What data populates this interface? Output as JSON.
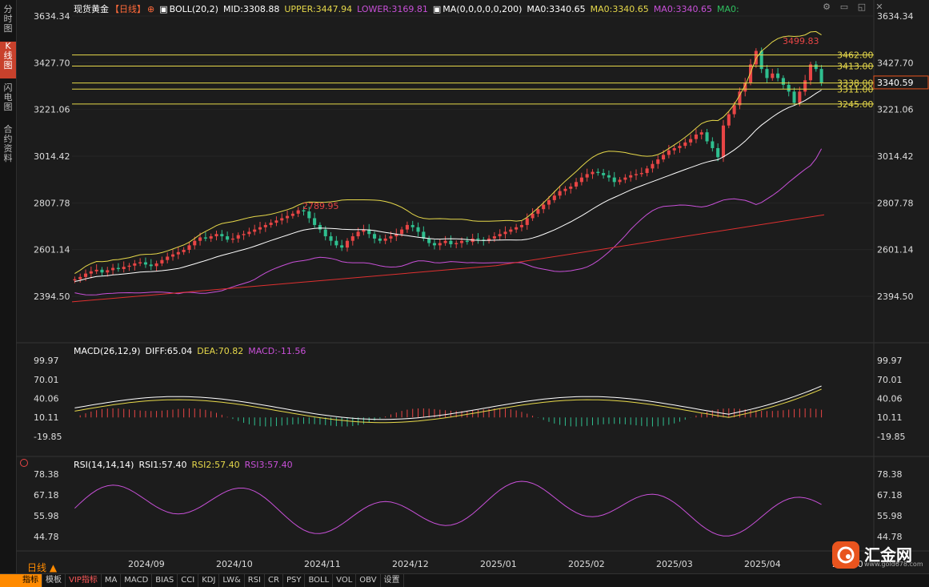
{
  "sidebar": {
    "tabs": [
      {
        "label": "分时图"
      },
      {
        "label": "K线图"
      },
      {
        "label": "闪电图"
      },
      {
        "label": "合约资料"
      }
    ]
  },
  "header": {
    "symbol": "现货黄金",
    "period": "【日线】",
    "boll": "BOLL(20,2)",
    "mid": "MID:3308.88",
    "upper": "UPPER:3447.94",
    "lower": "LOWER:3169.81",
    "ma": "MA(0,0,0,0,0,200)",
    "ma0a": "MA0:3340.65",
    "ma0b": "MA0:3340.65",
    "ma0c": "MA0:3340.65",
    "ma0d": "MA0:"
  },
  "macd_legend": {
    "title": "MACD(26,12,9)",
    "diff": "DIFF:65.04",
    "dea": "DEA:70.82",
    "macd": "MACD:-11.56"
  },
  "rsi_legend": {
    "title": "RSI(14,14,14)",
    "rsi1": "RSI1:57.40",
    "rsi2": "RSI2:57.40",
    "rsi3": "RSI3:57.40"
  },
  "price_axis": [
    "3634.34",
    "3427.70",
    "3221.06",
    "3014.42",
    "2807.78",
    "2601.14",
    "2394.50"
  ],
  "macd_axis": [
    "99.97",
    "70.01",
    "40.06",
    "10.11",
    "-19.85"
  ],
  "rsi_axis": [
    "78.38",
    "67.18",
    "55.98",
    "44.78"
  ],
  "date_axis": [
    "2024/09",
    "2024/10",
    "2024/11",
    "2024/12",
    "2025/01",
    "2025/02",
    "2025/03",
    "2025/04",
    "2025/0"
  ],
  "hlines": [
    {
      "label": "3462.00",
      "value": 3462
    },
    {
      "label": "3413.00",
      "value": 3413
    },
    {
      "label": "3338.00",
      "value": 3338
    },
    {
      "label": "3311.00",
      "value": 3311
    },
    {
      "label": "3245.00",
      "value": 3245
    }
  ],
  "annotations": {
    "high": "3499.83",
    "peak": "2789.95"
  },
  "current_price": "3340.59",
  "period_label": "日线 ▲",
  "bottom_tabs": [
    "指标",
    "模板",
    "VIP指标",
    "MA",
    "MACD",
    "BIAS",
    "CCI",
    "KDJ",
    "LW&",
    "RSI",
    "CR",
    "PSY",
    "BOLL",
    "VOL",
    "OBV",
    "设置"
  ],
  "logo": {
    "text": "汇金网",
    "url": "www.gold678.com"
  },
  "colors": {
    "up": "#e84545",
    "down": "#2fbf8f",
    "boll_upper": "#e6d84a",
    "boll_mid": "#ffffff",
    "boll_lower": "#c850d8",
    "ma200": "#e03030"
  },
  "chart_data": {
    "type": "candlestick",
    "ylim": [
      2394.5,
      3634.34
    ],
    "closes": [
      2470,
      2480,
      2495,
      2505,
      2512,
      2500,
      2510,
      2520,
      2515,
      2525,
      2530,
      2540,
      2545,
      2535,
      2528,
      2540,
      2555,
      2570,
      2580,
      2590,
      2600,
      2620,
      2640,
      2655,
      2650,
      2660,
      2670,
      2660,
      2645,
      2650,
      2665,
      2670,
      2680,
      2690,
      2700,
      2710,
      2720,
      2730,
      2740,
      2750,
      2760,
      2775,
      2770,
      2740,
      2710,
      2690,
      2660,
      2640,
      2620,
      2610,
      2640,
      2660,
      2680,
      2690,
      2670,
      2650,
      2640,
      2650,
      2660,
      2670,
      2690,
      2710,
      2700,
      2680,
      2650,
      2630,
      2620,
      2630,
      2640,
      2625,
      2630,
      2640,
      2635,
      2650,
      2645,
      2640,
      2650,
      2660,
      2670,
      2680,
      2690,
      2700,
      2710,
      2740,
      2760,
      2780,
      2800,
      2820,
      2840,
      2860,
      2870,
      2880,
      2900,
      2920,
      2935,
      2945,
      2940,
      2930,
      2920,
      2900,
      2910,
      2920,
      2930,
      2935,
      2940,
      2960,
      2980,
      3000,
      3020,
      3040,
      3050,
      3060,
      3075,
      3090,
      3110,
      3120,
      3080,
      3050,
      3010,
      3150,
      3200,
      3240,
      3300,
      3340,
      3420,
      3480,
      3400,
      3360,
      3380,
      3360,
      3330,
      3300,
      3250,
      3300,
      3350,
      3420,
      3400,
      3340
    ]
  }
}
